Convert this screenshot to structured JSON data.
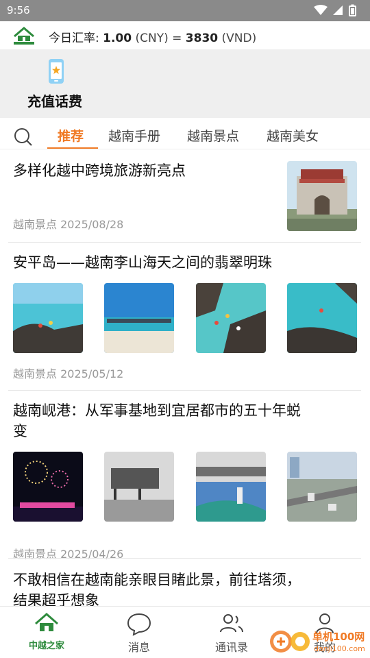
{
  "status_bar": {
    "time": "9:56"
  },
  "rate_bar": {
    "prefix": "今日汇率: ",
    "from_value": "1.00",
    "from_unit": " (CNY) = ",
    "to_value": "3830",
    "to_unit": " (VND)"
  },
  "panel": {
    "recharge_label": "充值话费"
  },
  "tabs": [
    {
      "label": "推荐"
    },
    {
      "label": "越南手册"
    },
    {
      "label": "越南景点"
    },
    {
      "label": "越南美女"
    }
  ],
  "feed": [
    {
      "title": "多样化越中跨境旅游新亮点",
      "category": "越南景点",
      "date": "2025/08/28"
    },
    {
      "title": "安平岛——越南李山海天之间的翡翠明珠",
      "category": "越南景点",
      "date": "2025/05/12"
    },
    {
      "title_line1": "越南岘港：从军事基地到宜居都市的五十年蜕",
      "title_line2": "变",
      "category": "越南景点",
      "date": "2025/04/26"
    },
    {
      "title_line1": "不敢相信在越南能亲眼目睹此景，前往塔须，",
      "title_line2": "结果超乎想象"
    }
  ],
  "bottom_nav": [
    {
      "label": "中越之家",
      "icon": "home-logo-icon"
    },
    {
      "label": "消息",
      "icon": "chat-icon"
    },
    {
      "label": "通讯录",
      "icon": "contacts-icon"
    },
    {
      "label": "我的",
      "icon": "user-icon"
    }
  ],
  "watermark": {
    "text": "单机100网",
    "sub": "danji100.com"
  },
  "colors": {
    "accent": "#f07a25",
    "brand_green": "#2e8b3d",
    "status_bar": "#8a8a8a"
  }
}
